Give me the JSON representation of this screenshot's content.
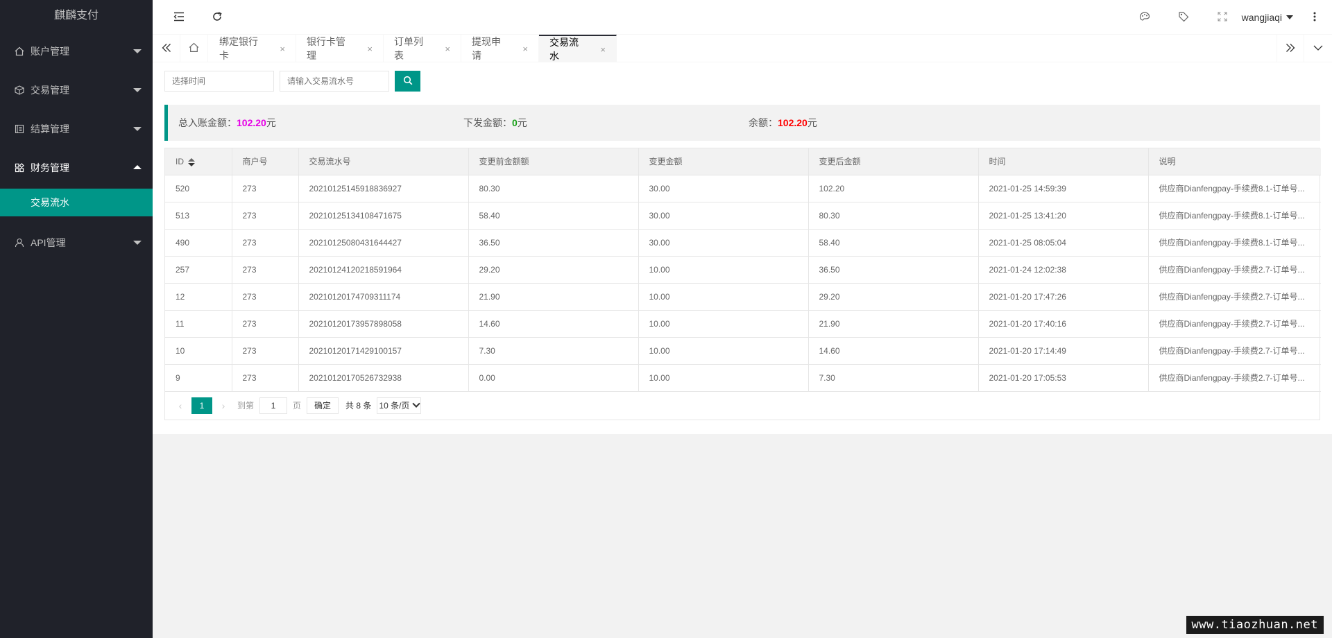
{
  "app": {
    "logo": "麒麟支付"
  },
  "sidebar": {
    "items": [
      {
        "label": "账户管理",
        "icon": "home-icon"
      },
      {
        "label": "交易管理",
        "icon": "cube-icon"
      },
      {
        "label": "结算管理",
        "icon": "ledger-icon"
      },
      {
        "label": "财务管理",
        "icon": "apps-icon"
      },
      {
        "label": "API管理",
        "icon": "user-icon"
      }
    ],
    "submenu_active": "交易流水"
  },
  "header": {
    "username": "wangjiaqi"
  },
  "tabs": [
    {
      "label": "绑定银行卡"
    },
    {
      "label": "银行卡管理"
    },
    {
      "label": "订单列表"
    },
    {
      "label": "提现申请"
    },
    {
      "label": "交易流水"
    }
  ],
  "tab_close_glyph": "×",
  "search": {
    "time_placeholder": "选择时间",
    "serial_placeholder": "请输入交易流水号"
  },
  "summary": {
    "total_in_label": "总入账金额：",
    "total_in_value": "102.20",
    "issued_label": "下发金额：",
    "issued_value": "0",
    "balance_label": "余额：",
    "balance_value": "102.20",
    "unit": "元",
    "colors": {
      "total_in": "#e600e6",
      "issued": "#1aa01a",
      "balance": "#ff0000"
    }
  },
  "table": {
    "columns": [
      "ID",
      "商户号",
      "交易流水号",
      "变更前金额额",
      "变更金额",
      "变更后金额",
      "时间",
      "说明"
    ],
    "rows": [
      [
        "520",
        "273",
        "20210125145918836927",
        "80.30",
        "30.00",
        "102.20",
        "2021-01-25 14:59:39",
        "供应商Dianfengpay-手续费8.1-订单号..."
      ],
      [
        "513",
        "273",
        "20210125134108471675",
        "58.40",
        "30.00",
        "80.30",
        "2021-01-25 13:41:20",
        "供应商Dianfengpay-手续费8.1-订单号..."
      ],
      [
        "490",
        "273",
        "20210125080431644427",
        "36.50",
        "30.00",
        "58.40",
        "2021-01-25 08:05:04",
        "供应商Dianfengpay-手续费8.1-订单号..."
      ],
      [
        "257",
        "273",
        "20210124120218591964",
        "29.20",
        "10.00",
        "36.50",
        "2021-01-24 12:02:38",
        "供应商Dianfengpay-手续费2.7-订单号..."
      ],
      [
        "12",
        "273",
        "20210120174709311174",
        "21.90",
        "10.00",
        "29.20",
        "2021-01-20 17:47:26",
        "供应商Dianfengpay-手续费2.7-订单号..."
      ],
      [
        "11",
        "273",
        "20210120173957898058",
        "14.60",
        "10.00",
        "21.90",
        "2021-01-20 17:40:16",
        "供应商Dianfengpay-手续费2.7-订单号..."
      ],
      [
        "10",
        "273",
        "20210120171429100157",
        "7.30",
        "10.00",
        "14.60",
        "2021-01-20 17:14:49",
        "供应商Dianfengpay-手续费2.7-订单号..."
      ],
      [
        "9",
        "273",
        "20210120170526732938",
        "0.00",
        "10.00",
        "7.30",
        "2021-01-20 17:05:53",
        "供应商Dianfengpay-手续费2.7-订单号..."
      ]
    ]
  },
  "pager": {
    "current": "1",
    "goto_label": "到第",
    "page_input": "1",
    "page_unit": "页",
    "confirm": "确定",
    "total": "共 8 条",
    "page_size": "10 条/页"
  },
  "watermark": "www.tiaozhuan.net",
  "accent": "#009688"
}
